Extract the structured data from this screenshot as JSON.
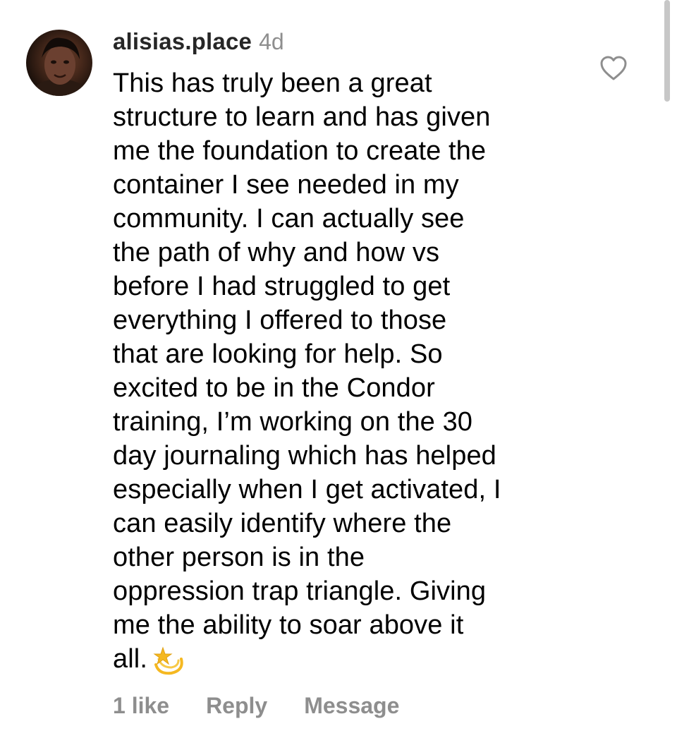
{
  "comment": {
    "username": "alisias.place",
    "time": "4d",
    "text": "This has truly been a great\nstructure to learn and has given\nme the foundation to create the\ncontainer I see needed in my\ncommunity. I can actually see\nthe path of why and how vs\nbefore I had struggled to get\neverything I offered to those\nthat are looking for help. So\nexcited to be in the Condor\ntraining, I’m working on the 30\nday journaling which has helped\nespecially when I get activated, I\ncan easily identify where the\nother person is in the\noppression trap triangle. Giving\nme the ability to soar above it\nall.",
    "emoji_icon": "dizzy-star-emoji",
    "like_icon": "heart-outline-icon",
    "avatar_icon": "profile-photo"
  },
  "actions": {
    "likes_label": "1 like",
    "reply_label": "Reply",
    "message_label": "Message"
  },
  "colors": {
    "text": "#000000",
    "username": "#262626",
    "secondary": "#8e8e8e",
    "emoji": "#f5b820"
  }
}
